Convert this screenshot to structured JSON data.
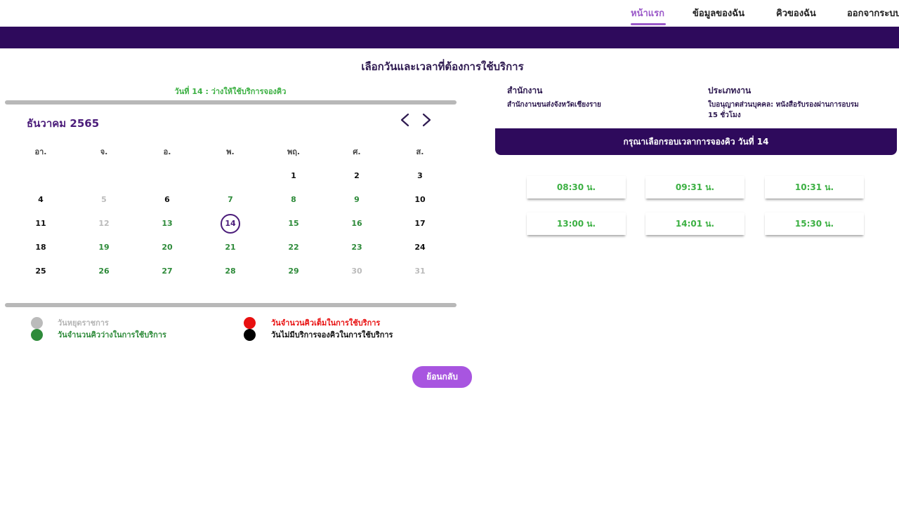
{
  "nav": {
    "items": [
      {
        "label": "หน้าแรก",
        "active": true
      },
      {
        "label": "ข้อมูลของฉัน",
        "active": false
      },
      {
        "label": "คิวของฉัน",
        "active": false
      },
      {
        "label": "ออกจากระบบ",
        "active": false
      }
    ]
  },
  "page_title": "เลือกวันและเวลาที่ต้องการใช้บริการ",
  "calendar": {
    "availability_note": "วันที่ 14 : ว่างให้ใช้บริการจองคิว",
    "month_title": "ธันวาคม 2565",
    "weekdays": [
      "อา.",
      "จ.",
      "อ.",
      "พ.",
      "พฤ.",
      "ศ.",
      "ส."
    ],
    "weeks": [
      [
        null,
        null,
        null,
        null,
        {
          "d": "1",
          "s": "black"
        },
        {
          "d": "2",
          "s": "black"
        },
        {
          "d": "3",
          "s": "black"
        }
      ],
      [
        {
          "d": "4",
          "s": "black"
        },
        {
          "d": "5",
          "s": "gray"
        },
        {
          "d": "6",
          "s": "black"
        },
        {
          "d": "7",
          "s": "green"
        },
        {
          "d": "8",
          "s": "green"
        },
        {
          "d": "9",
          "s": "green"
        },
        {
          "d": "10",
          "s": "black"
        }
      ],
      [
        {
          "d": "11",
          "s": "black"
        },
        {
          "d": "12",
          "s": "gray"
        },
        {
          "d": "13",
          "s": "green"
        },
        {
          "d": "14",
          "s": "selected"
        },
        {
          "d": "15",
          "s": "green"
        },
        {
          "d": "16",
          "s": "green"
        },
        {
          "d": "17",
          "s": "black"
        }
      ],
      [
        {
          "d": "18",
          "s": "black"
        },
        {
          "d": "19",
          "s": "green"
        },
        {
          "d": "20",
          "s": "green"
        },
        {
          "d": "21",
          "s": "green"
        },
        {
          "d": "22",
          "s": "green"
        },
        {
          "d": "23",
          "s": "green"
        },
        {
          "d": "24",
          "s": "black"
        }
      ],
      [
        {
          "d": "25",
          "s": "black"
        },
        {
          "d": "26",
          "s": "green"
        },
        {
          "d": "27",
          "s": "green"
        },
        {
          "d": "28",
          "s": "green"
        },
        {
          "d": "29",
          "s": "green"
        },
        {
          "d": "30",
          "s": "gray"
        },
        {
          "d": "31",
          "s": "gray"
        }
      ]
    ]
  },
  "legend": {
    "holiday": "วันหยุดราชการ",
    "available": "วันจำนวนคิวว่างในการใช้บริการ",
    "full": "วันจำนวนคิวเต็มในการใช้บริการ",
    "no_service": "วันไม่มีบริการจองคิวในการใช้บริการ"
  },
  "back_label": "ย้อนกลับ",
  "info": {
    "office_label": "สำนักงาน",
    "office_value": "สำนักงานขนส่งจังหวัดเชียงราย",
    "type_label": "ประเภทงาน",
    "type_value_line1": "ใบอนุญาตส่วนบุคคล: หนังสือรับรองผ่านการอบรม",
    "type_value_line2": "15 ชั่วโมง"
  },
  "slots": {
    "header": "กรุณาเลือกรอบเวลาการจองคิว วันที่ 14",
    "times": [
      "08:30 น.",
      "09:31 น.",
      "10:31 น.",
      "13:00 น.",
      "14:01 น.",
      "15:30 น."
    ]
  },
  "colors": {
    "brand_dark": "#2e0a5c",
    "accent": "#9b59c9",
    "available_green": "#3cb043",
    "holiday_gray": "#bbbbbb",
    "full_red": "#e81010",
    "none_black": "#000000"
  }
}
